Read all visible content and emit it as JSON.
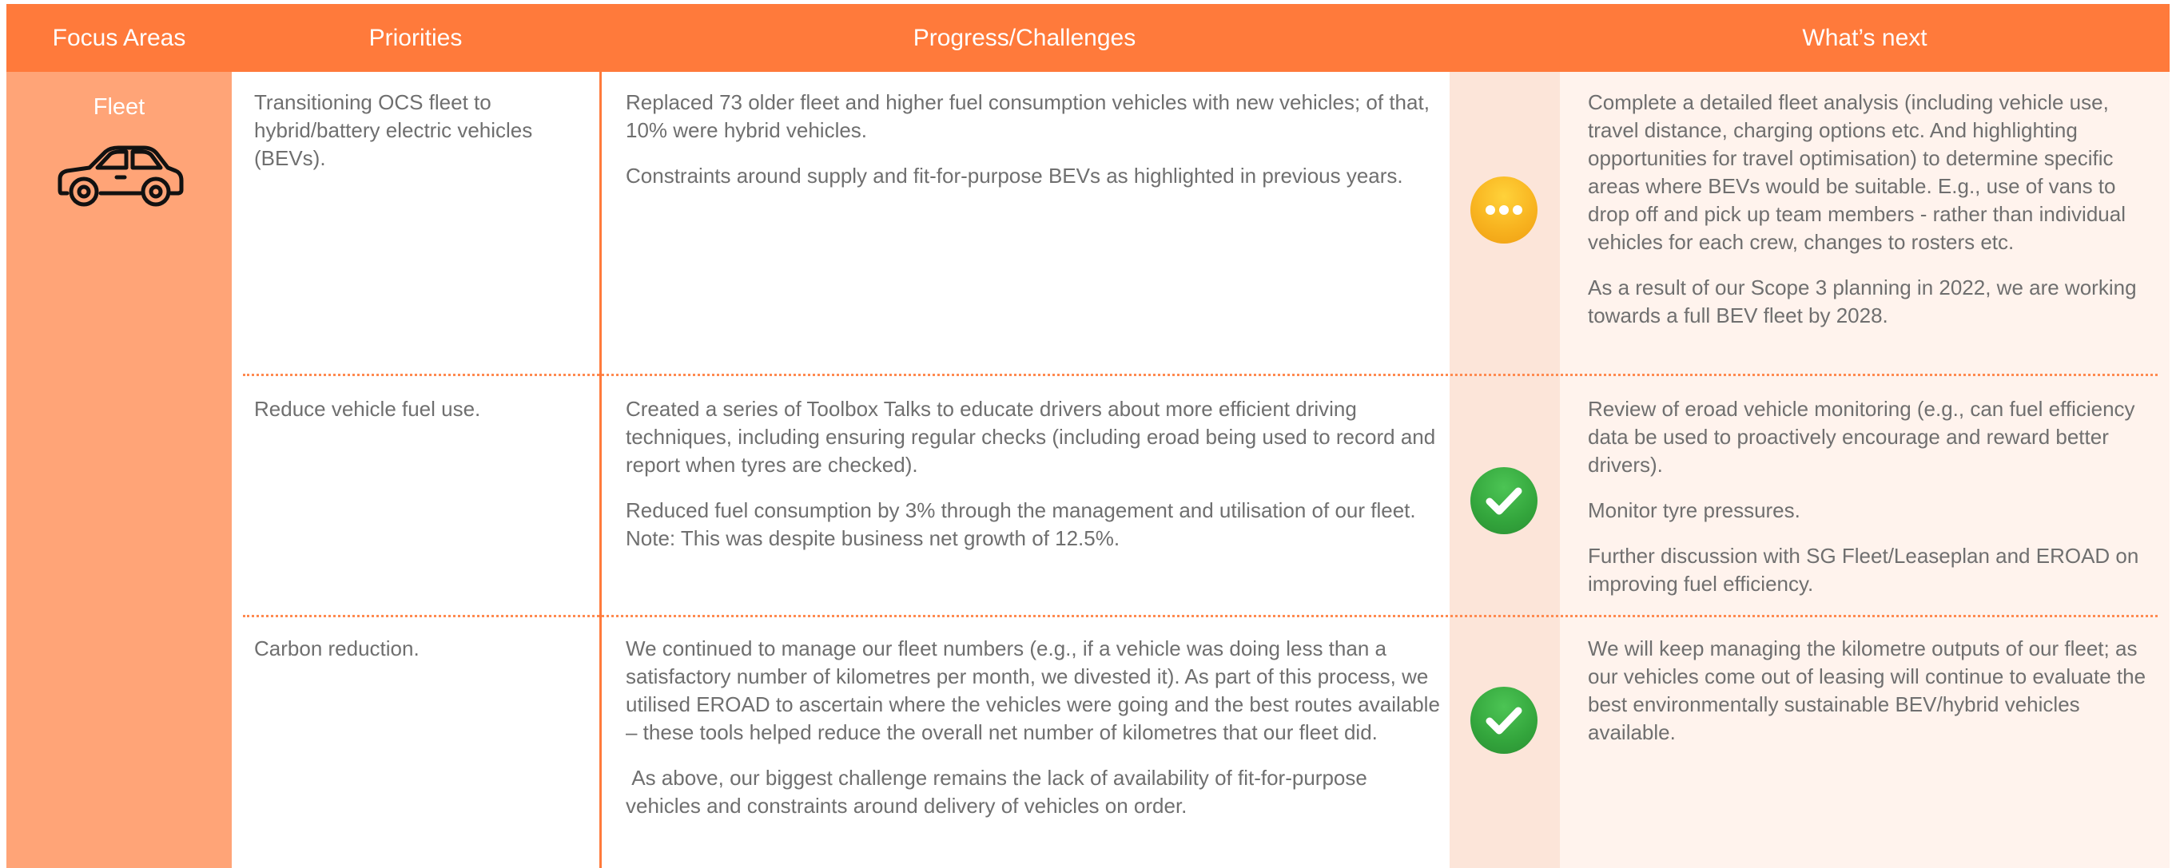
{
  "header": {
    "focus_areas": "Focus Areas",
    "priorities": "Priorities",
    "progress": "Progress/Challenges",
    "whats_next": "What’s next"
  },
  "focus": {
    "name": "Fleet",
    "icon": "car-icon"
  },
  "colors": {
    "header": "#FF7A3B",
    "focus_column": "#FFA477",
    "status_column": "#FCE5D9",
    "next_column": "#FFF3ED",
    "text": "#6F6F6F",
    "in_progress": "#F8B420",
    "complete": "#33A53C"
  },
  "rows": [
    {
      "priority": "Transitioning OCS fleet to hybrid/battery electric vehicles (BEVs).",
      "progress": [
        "Replaced 73 older fleet and higher fuel consumption vehicles with new vehicles; of that, 10% were hybrid vehicles.",
        "Constraints around supply and fit-for-purpose BEVs as highlighted in previous years."
      ],
      "status": "in-progress",
      "status_icon": "ellipsis-icon",
      "next": [
        "Complete a detailed fleet analysis (including vehicle use, travel distance, charging options etc. And highlighting opportunities for travel optimisation) to determine specific areas where BEVs would be suitable. E.g., use of vans to drop off and pick up team members - rather than individual vehicles for each crew, changes to rosters etc.",
        "As a result of our Scope 3 planning in 2022, we are working towards a full BEV fleet by 2028."
      ]
    },
    {
      "priority": "Reduce vehicle fuel use.",
      "progress": [
        "Created a series of Toolbox Talks to educate drivers about more efficient driving techniques, including ensuring regular checks (including eroad being used to record and report when tyres are checked).",
        "Reduced fuel consumption by 3% through the management and utilisation of our fleet. Note: This was despite business net growth of 12.5%."
      ],
      "status": "complete",
      "status_icon": "checkmark-icon",
      "next": [
        "Review of eroad vehicle monitoring (e.g., can fuel efficiency data be used to proactively encourage and reward better drivers).",
        "Monitor tyre pressures.",
        "Further discussion with SG Fleet/Leaseplan and EROAD on improving fuel efficiency."
      ]
    },
    {
      "priority": "Carbon reduction.",
      "progress": [
        "We continued to manage our fleet numbers (e.g., if a vehicle was doing less than a satisfactory number of kilometres per month, we divested it). As part of this process, we utilised EROAD to ascertain where the vehicles were going and the best routes available – these tools helped reduce the overall net number of kilometres that our fleet did.",
        " As above, our biggest challenge remains the lack of availability of fit-for-purpose vehicles and constraints around delivery of vehicles on order."
      ],
      "status": "complete",
      "status_icon": "checkmark-icon",
      "next": [
        "We will keep managing the kilometre outputs of our fleet; as our vehicles come out of leasing will continue to evaluate the best environmentally sustainable BEV/hybrid vehicles available."
      ]
    }
  ]
}
